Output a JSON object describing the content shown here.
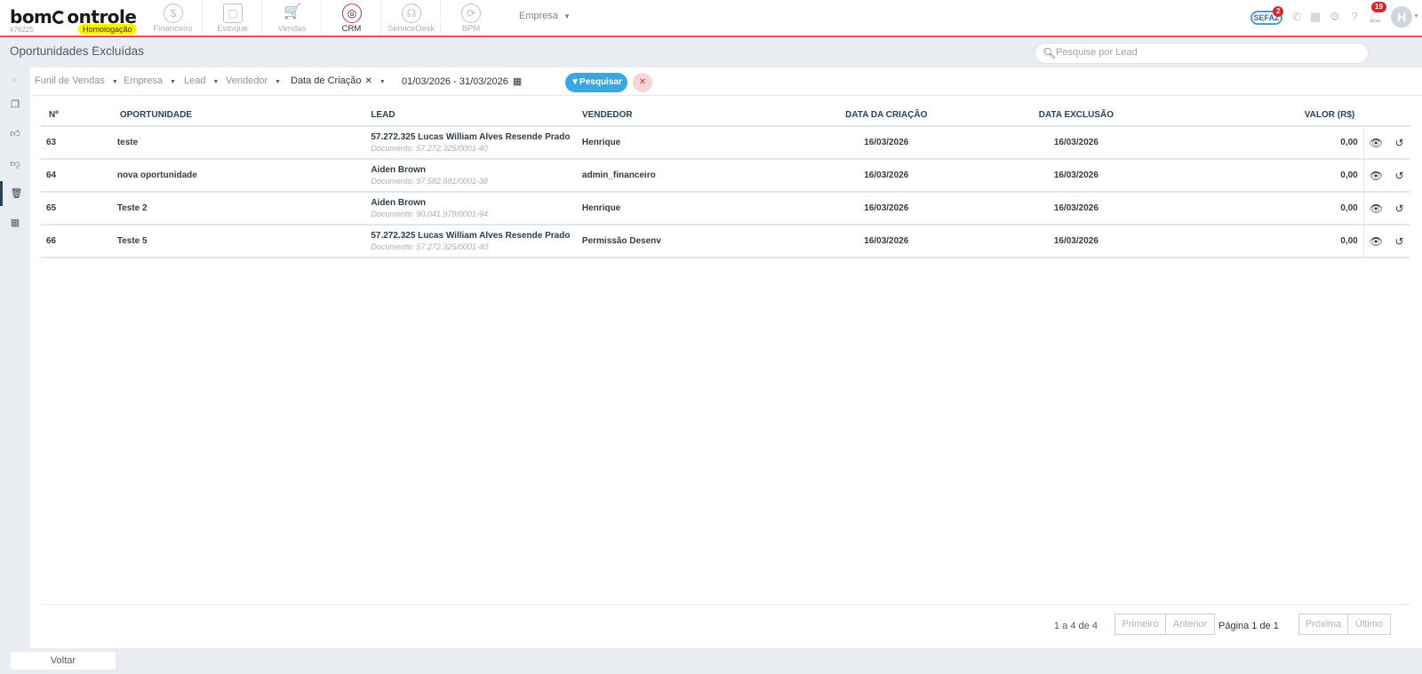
{
  "header": {
    "logo": "bomcontrole",
    "account_id": "#76225",
    "environment": "Homologação",
    "modules": [
      {
        "label": "Financeiro",
        "icon": "dollar-icon"
      },
      {
        "label": "Estoque",
        "icon": "box-icon"
      },
      {
        "label": "Vendas",
        "icon": "cart-icon"
      },
      {
        "label": "CRM",
        "icon": "target-icon"
      },
      {
        "label": "ServiceDesk",
        "icon": "headset-icon"
      },
      {
        "label": "BPM",
        "icon": "flow-icon"
      }
    ],
    "company_selector": "Empresa",
    "sefaz_label": "SEFAZ",
    "sefaz_badge": "2",
    "notifications_badge": "19",
    "avatar_initial": "H"
  },
  "page": {
    "title": "Oportunidades Excluídas",
    "search_placeholder": "Pesquise por Lead"
  },
  "filters": {
    "funil": "Funil de Vendas",
    "empresa": "Empresa",
    "lead": "Lead",
    "vendedor": "Vendedor",
    "data_criacao": "Data de Criação",
    "date_range": "01/03/2026 - 31/03/2026",
    "search_button": "Pesquisar"
  },
  "table": {
    "headers": {
      "num": "Nº",
      "oportunidade": "OPORTUNIDADE",
      "lead": "LEAD",
      "vendedor": "VENDEDOR",
      "data_criacao": "DATA DA CRIAÇÃO",
      "data_exclusao": "DATA EXCLUSÃO",
      "valor": "VALOR (R$)"
    },
    "rows": [
      {
        "num": "63",
        "oportunidade": "teste",
        "lead": "57.272.325 Lucas William Alves Resende Prado",
        "documento": "Documento: 57.272.325/0001-40",
        "vendedor": "Henrique",
        "data_criacao": "16/03/2026",
        "data_exclusao": "16/03/2026",
        "valor": "0,00"
      },
      {
        "num": "64",
        "oportunidade": "nova oportunidade",
        "lead": "Aiden Brown",
        "documento": "Documento: 97.582.881/0001-38",
        "vendedor": "admin_financeiro",
        "data_criacao": "16/03/2026",
        "data_exclusao": "16/03/2026",
        "valor": "0,00"
      },
      {
        "num": "65",
        "oportunidade": "Teste 2",
        "lead": "Aiden Brown",
        "documento": "Documento: 90.041.978/0001-94",
        "vendedor": "Henrique",
        "data_criacao": "16/03/2026",
        "data_exclusao": "16/03/2026",
        "valor": "0,00"
      },
      {
        "num": "66",
        "oportunidade": "Teste 5",
        "lead": "57.272.325 Lucas William Alves Resende Prado",
        "documento": "Documento: 57.272.325/0001-40",
        "vendedor": "Permissão Desenv",
        "data_criacao": "16/03/2026",
        "data_exclusao": "16/03/2026",
        "valor": "0,00"
      }
    ]
  },
  "pagination": {
    "count": "1 a 4 de 4",
    "first": "Primeiro",
    "previous": "Anterior",
    "page": "Página 1 de 1",
    "next": "Próxima",
    "last": "Último"
  },
  "footer": {
    "back": "Voltar"
  }
}
